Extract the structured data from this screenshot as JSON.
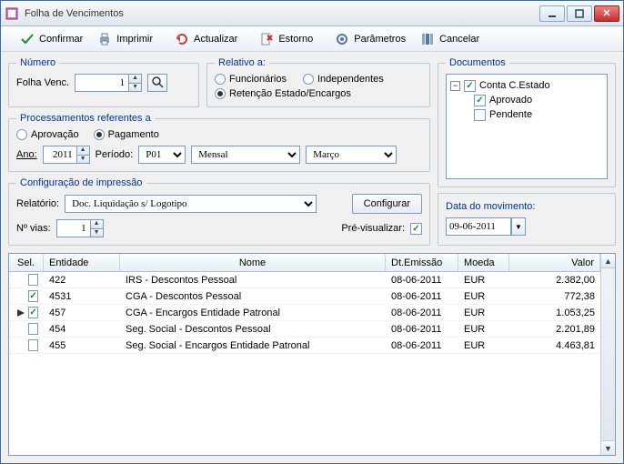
{
  "window": {
    "title": "Folha de Vencimentos"
  },
  "toolbar": {
    "confirmar": "Confirmar",
    "imprimir": "Imprimir",
    "actualizar": "Actualizar",
    "estorno": "Estorno",
    "parametros": "Parâmetros",
    "cancelar": "Cancelar"
  },
  "numero": {
    "legend": "Número",
    "label": "Folha Venc.",
    "value": "1"
  },
  "relativo": {
    "legend": "Relativo a:",
    "funcionarios": "Funcionários",
    "independentes": "Independentes",
    "retencao": "Retenção Estado/Encargos",
    "selected": "retencao"
  },
  "documentos": {
    "legend": "Documentos",
    "root": "Conta C.Estado",
    "root_checked": true,
    "children": [
      {
        "label": "Aprovado",
        "checked": true
      },
      {
        "label": "Pendente",
        "checked": false
      }
    ]
  },
  "processamentos": {
    "legend": "Processamentos referentes a",
    "aprovacao": "Aprovação",
    "pagamento": "Pagamento",
    "selected": "pagamento",
    "ano_label": "Ano:",
    "ano_value": "2011",
    "periodo_label": "Período:",
    "periodo_value": "P01",
    "tipo_value": "Mensal",
    "mes_value": "Março"
  },
  "impressao": {
    "legend": "Configuração de impressão",
    "relatorio_label": "Relatório:",
    "relatorio_value": "Doc. Liquidação s/ Logotipo",
    "configurar": "Configurar",
    "nvias_label": "Nº vias:",
    "nvias_value": "1",
    "previsualizar_label": "Pré-visualizar:",
    "previsualizar_checked": true
  },
  "data_movimento": {
    "label": "Data do movimento:",
    "value": "09-06-2011"
  },
  "grid": {
    "headers": {
      "sel": "Sel.",
      "entidade": "Entidade",
      "nome": "Nome",
      "dtemissao": "Dt.Emissão",
      "moeda": "Moeda",
      "valor": "Valor"
    },
    "rows": [
      {
        "sel": false,
        "entidade": "422",
        "nome": "IRS - Descontos Pessoal",
        "dt": "08-06-2011",
        "moeda": "EUR",
        "valor": "2.382,00",
        "current": false
      },
      {
        "sel": true,
        "entidade": "4531",
        "nome": "CGA - Descontos Pessoal",
        "dt": "08-06-2011",
        "moeda": "EUR",
        "valor": "772,38",
        "current": false
      },
      {
        "sel": true,
        "entidade": "457",
        "nome": "CGA - Encargos Entidade Patronal",
        "dt": "08-06-2011",
        "moeda": "EUR",
        "valor": "1.053,25",
        "current": true
      },
      {
        "sel": false,
        "entidade": "454",
        "nome": "Seg. Social - Descontos Pessoal",
        "dt": "08-06-2011",
        "moeda": "EUR",
        "valor": "2.201,89",
        "current": false
      },
      {
        "sel": false,
        "entidade": "455",
        "nome": "Seg. Social - Encargos Entidade Patronal",
        "dt": "08-06-2011",
        "moeda": "EUR",
        "valor": "4.463,81",
        "current": false
      }
    ]
  }
}
